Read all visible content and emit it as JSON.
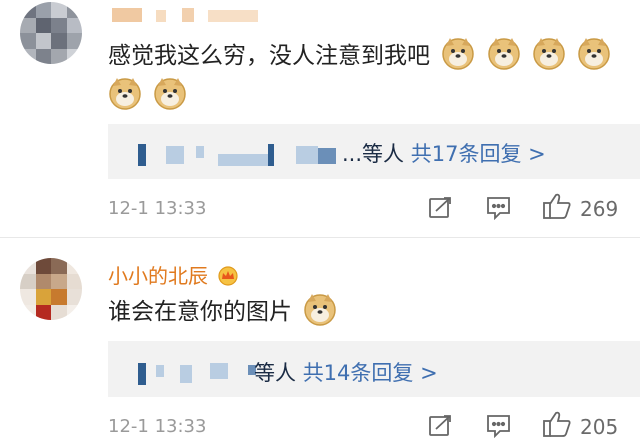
{
  "comments": [
    {
      "author": "",
      "text": "感觉我这么穷，没人注意到我吧",
      "replies_users_suffix": "...等人",
      "replies_count_label": "共17条回复 >",
      "time": "12-1 13:33",
      "likes": "269",
      "emoji": "doge-emoji"
    },
    {
      "author": "小小的北辰",
      "text": "谁会在意你的图片",
      "replies_users_suffix": "等人",
      "replies_count_label": "共14条回复 >",
      "time": "12-1 13:33",
      "likes": "205",
      "emoji": "doge-emoji"
    }
  ],
  "colors": {
    "author_name": "#e07a1f",
    "reply_link": "#3f6fb0",
    "reply_background": "#f2f2f2",
    "meta_text": "#9a9a9a"
  },
  "icons": [
    "share-icon",
    "comment-icon",
    "like-icon",
    "crown-icon"
  ]
}
